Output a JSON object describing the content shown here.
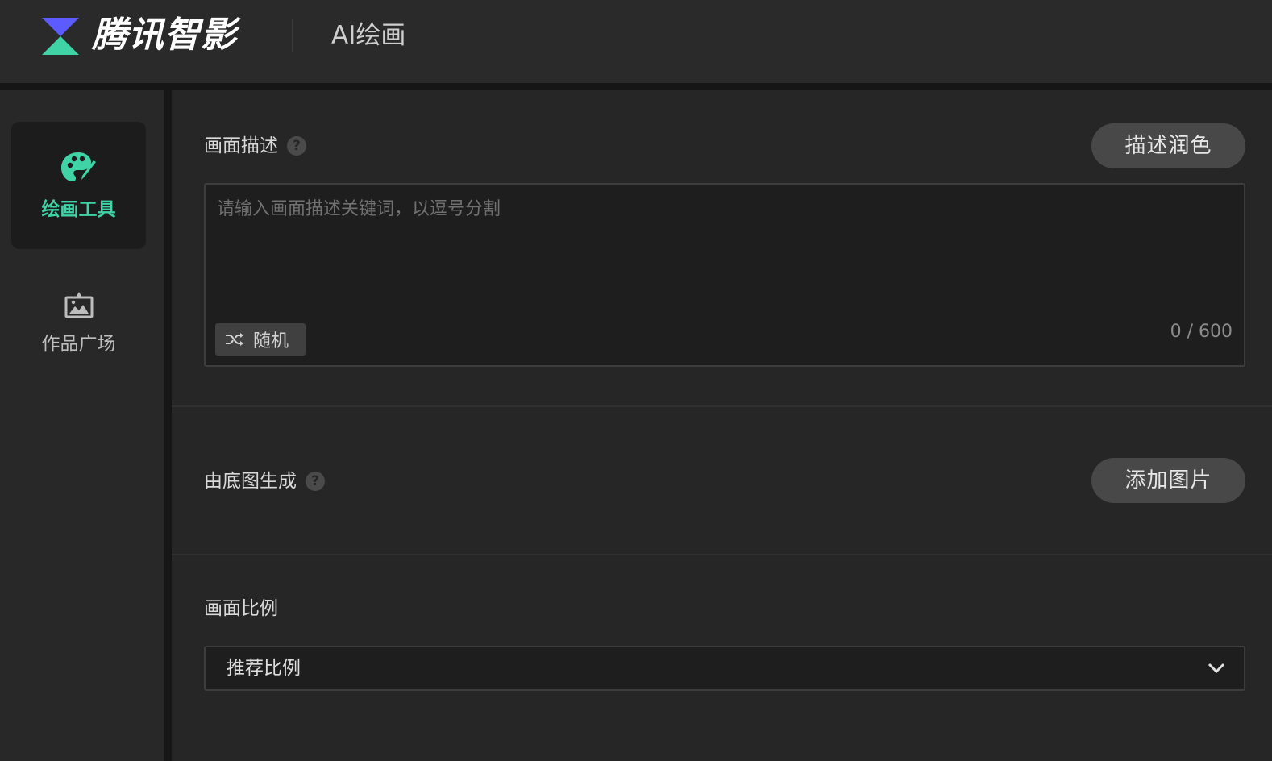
{
  "header": {
    "brand": "腾讯智影",
    "title": "AI绘画",
    "logo_icon": "tencent-zenvideo-logo-icon",
    "colors": {
      "logo_top": "#5b5bff",
      "logo_bottom": "#3fd3a5"
    }
  },
  "sidebar": {
    "items": [
      {
        "label": "绘画工具",
        "icon": "palette-icon",
        "active": true
      },
      {
        "label": "作品广场",
        "icon": "gallery-icon",
        "active": false
      }
    ],
    "accent_color": "#3fd3a5"
  },
  "main": {
    "description": {
      "label": "画面描述",
      "help_icon": "question-circle-icon",
      "polish_button": "描述润色",
      "placeholder": "请输入画面描述关键词，以逗号分割",
      "value": "",
      "random_button": "随机",
      "random_icon": "shuffle-icon",
      "counter": "0 / 600"
    },
    "base_image": {
      "label": "由底图生成",
      "help_icon": "question-circle-icon",
      "add_button": "添加图片"
    },
    "ratio": {
      "label": "画面比例",
      "selected": "推荐比例",
      "chevron_icon": "chevron-down-icon"
    }
  }
}
